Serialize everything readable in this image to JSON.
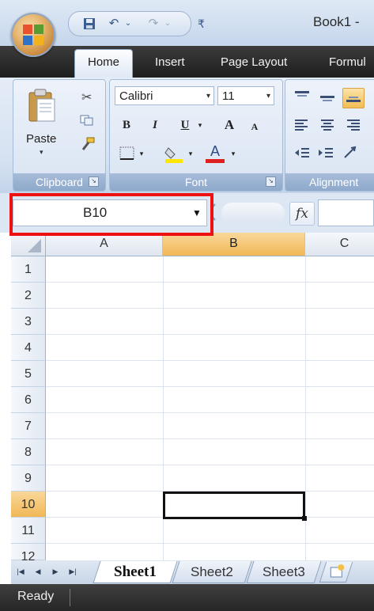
{
  "title": {
    "text": "Book1 -"
  },
  "qat": {
    "save_icon": "save-icon",
    "undo_icon": "undo-icon",
    "redo_icon": "redo-icon"
  },
  "tabs": [
    {
      "label": "Home",
      "active": true
    },
    {
      "label": "Insert"
    },
    {
      "label": "Page Layout"
    },
    {
      "label": "Formul"
    }
  ],
  "ribbon": {
    "clipboard": {
      "label": "Clipboard",
      "paste_label": "Paste"
    },
    "font": {
      "label": "Font",
      "font_name": "Calibri",
      "font_size": "11",
      "bold": "B",
      "italic": "I",
      "underline": "U",
      "grow": "A",
      "shrink": "A",
      "font_color_letter": "A",
      "font_color": "#e02020",
      "fill_color": "#ffe600"
    },
    "alignment": {
      "label": "Alignment"
    }
  },
  "formula_bar": {
    "name_box": "B10",
    "fx": "fx",
    "content": ""
  },
  "grid": {
    "columns": [
      "A",
      "B",
      "C"
    ],
    "rows": [
      "1",
      "2",
      "3",
      "4",
      "5",
      "6",
      "7",
      "8",
      "9",
      "10",
      "11",
      "12"
    ],
    "selected_column": "B",
    "selected_row": "10",
    "active_cell": "B10"
  },
  "sheets": [
    {
      "label": "Sheet1",
      "active": true
    },
    {
      "label": "Sheet2"
    },
    {
      "label": "Sheet3"
    }
  ],
  "status": {
    "text": "Ready"
  },
  "colors": {
    "highlight_box": "#ee1111",
    "selected_header": "#f1b756"
  }
}
